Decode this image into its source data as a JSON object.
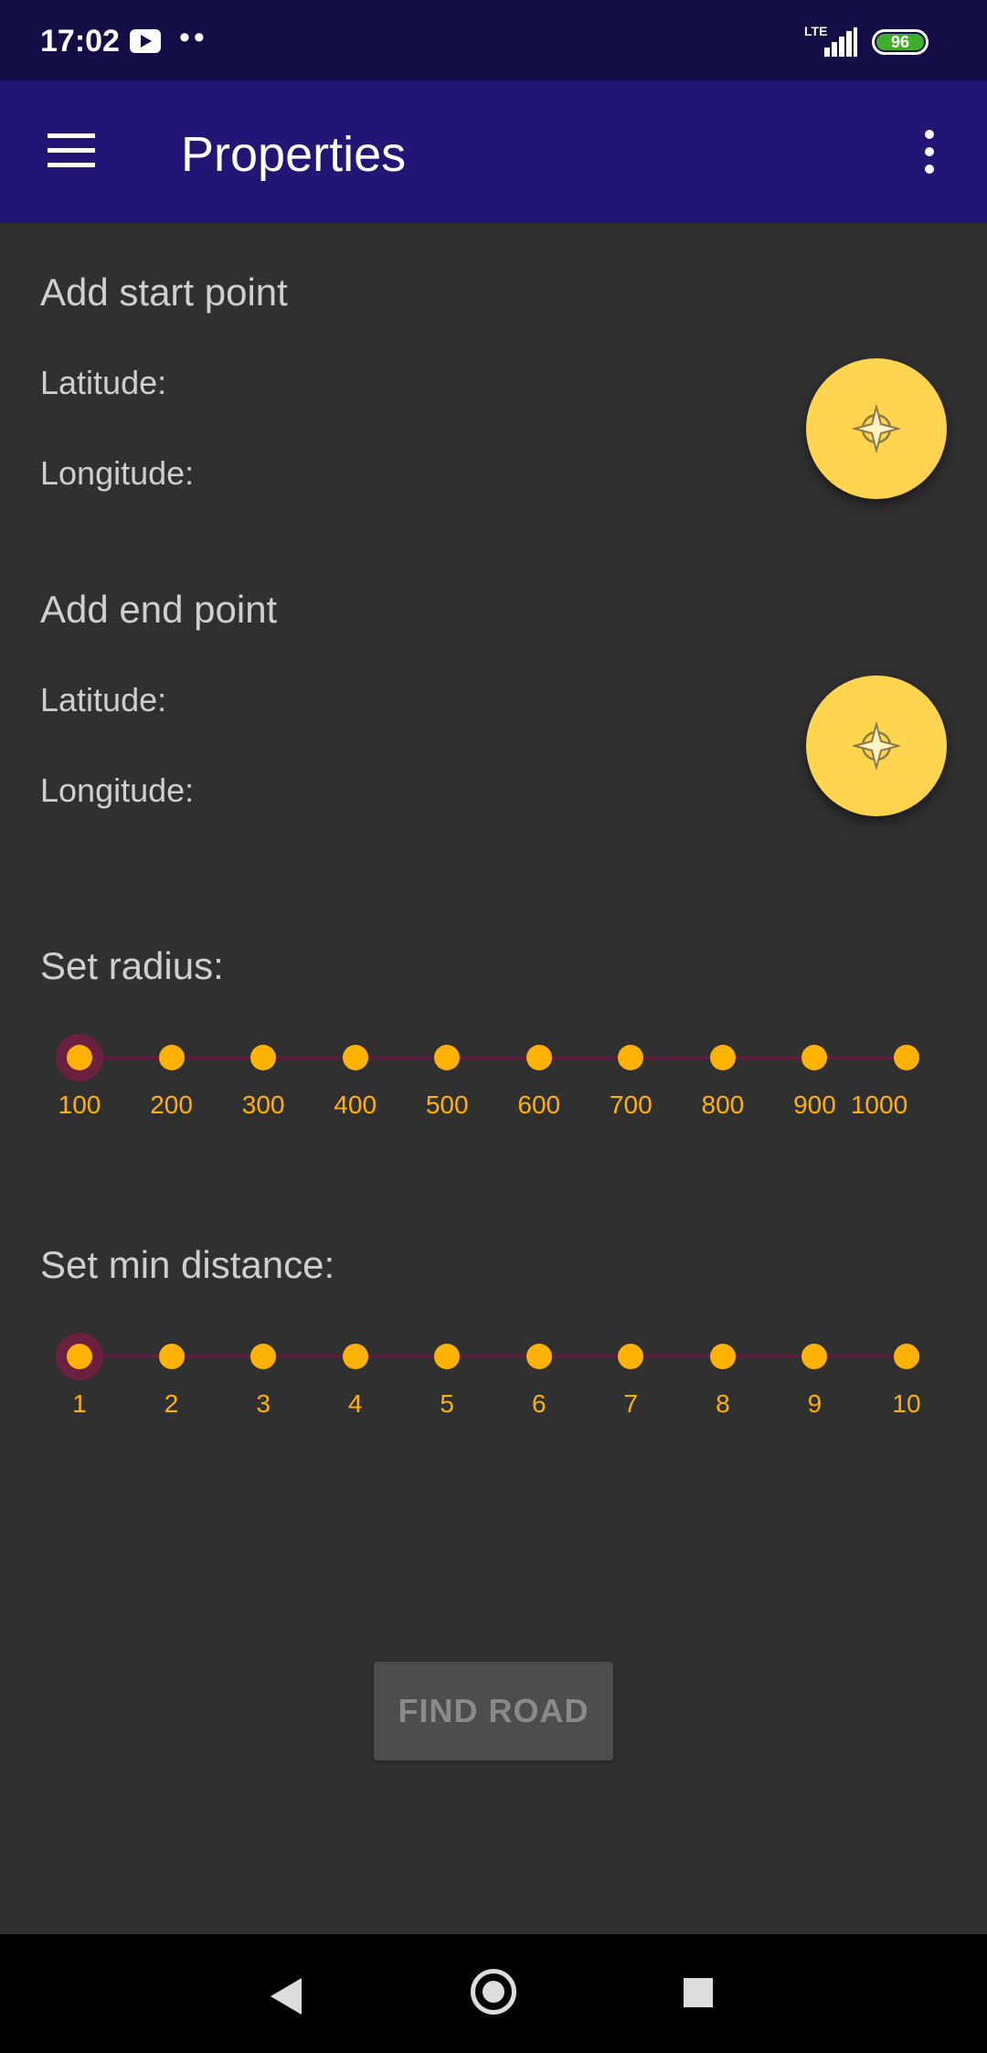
{
  "status_bar": {
    "time": "17:02",
    "network": "LTE",
    "battery": "96",
    "icons": [
      "youtube-icon",
      "signal-icon",
      "battery-icon"
    ]
  },
  "app_bar": {
    "title": "Properties",
    "icons": [
      "menu-icon",
      "overflow-menu-icon"
    ]
  },
  "start_point": {
    "title": "Add start point",
    "latitude_label": "Latitude:",
    "longitude_label": "Longitude:",
    "fab_icon": "crosshair-icon"
  },
  "end_point": {
    "title": "Add end point",
    "latitude_label": "Latitude:",
    "longitude_label": "Longitude:",
    "fab_icon": "crosshair-icon"
  },
  "radius": {
    "title": "Set radius:",
    "ticks": [
      "100",
      "200",
      "300",
      "400",
      "500",
      "600",
      "700",
      "800",
      "900",
      "1000"
    ],
    "selected": "100"
  },
  "min_distance": {
    "title": "Set min distance:",
    "ticks": [
      "1",
      "2",
      "3",
      "4",
      "5",
      "6",
      "7",
      "8",
      "9",
      "10"
    ],
    "selected": "1"
  },
  "find_button": {
    "label": "FIND ROAD"
  },
  "colors": {
    "app_bar": "#231575",
    "status_bar": "#150d45",
    "background": "#303030",
    "accent": "#ffb300",
    "fab": "#ffd54f"
  },
  "nav_bar": {
    "icons": [
      "back-icon",
      "home-icon",
      "recents-icon"
    ]
  }
}
